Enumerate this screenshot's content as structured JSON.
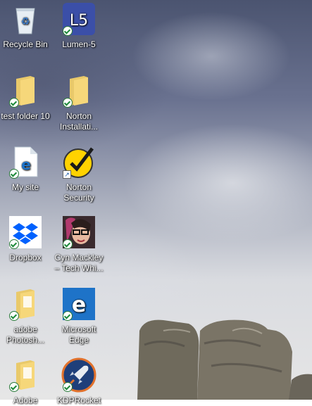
{
  "desktop": {
    "icons": [
      {
        "name": "recycle-bin",
        "label": "Recycle Bin",
        "icon": "recycle-bin-icon"
      },
      {
        "name": "lumen5",
        "label": "Lumen-5",
        "icon": "lumen5-icon",
        "badge": "L5"
      },
      {
        "name": "test-folder-10",
        "label": "test folder 10",
        "icon": "folder-icon"
      },
      {
        "name": "norton-installation",
        "label": "Norton\nInstallati...",
        "icon": "folder-icon"
      },
      {
        "name": "my-site",
        "label": "My site",
        "icon": "edge-document-icon"
      },
      {
        "name": "norton-security",
        "label": "Norton\nSecurity",
        "icon": "norton-icon"
      },
      {
        "name": "dropbox",
        "label": "Dropbox",
        "icon": "dropbox-icon"
      },
      {
        "name": "cyn-mackley",
        "label": "Cyn Mackley\n– Tech Whi...",
        "icon": "profile-photo-icon"
      },
      {
        "name": "adobe-photoshop",
        "label": "adobe\nPhotosh...",
        "icon": "folder-icon"
      },
      {
        "name": "microsoft-edge",
        "label": "Microsoft\nEdge",
        "icon": "edge-icon"
      },
      {
        "name": "adobe",
        "label": "Adobe",
        "icon": "folder-icon"
      },
      {
        "name": "kdp-rocket",
        "label": "KDPRocket",
        "icon": "rocket-icon"
      }
    ]
  },
  "colors": {
    "sync_check": "#1e8a3a",
    "lumen_bg": "#3b4fa8",
    "edge_blue": "#1e73c8",
    "dropbox_blue": "#0061fe",
    "norton_yellow": "#ffd200"
  }
}
